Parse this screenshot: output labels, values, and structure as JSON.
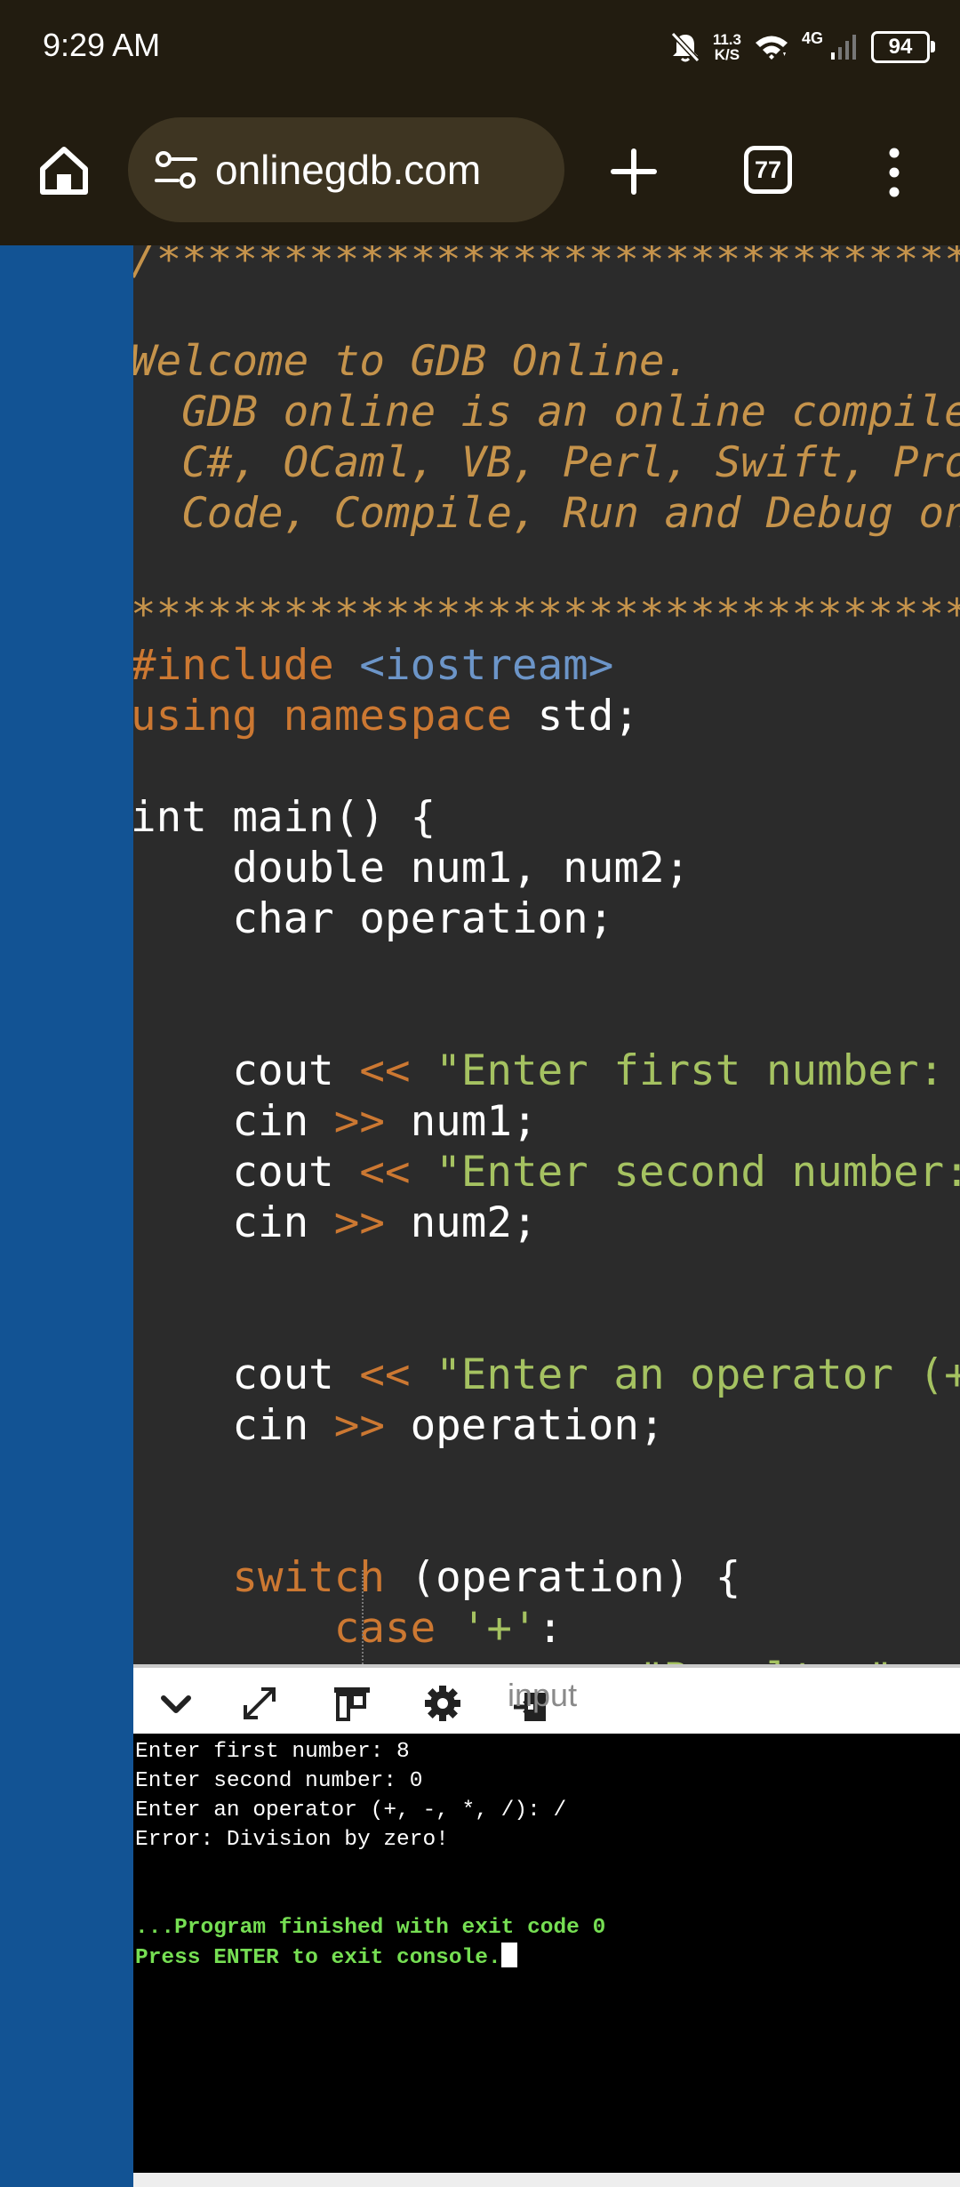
{
  "status_bar": {
    "time": "9:29 AM",
    "net_speed_value": "11.3",
    "net_speed_unit": "K/S",
    "network_type": "4G",
    "battery": "94"
  },
  "browser": {
    "url": "onlinegdb.com",
    "tab_count": "77"
  },
  "editor": {
    "lines": [
      [
        {
          "t": "/************************************",
          "c": "cm"
        }
      ],
      [
        {
          "t": "",
          "c": ""
        }
      ],
      [
        {
          "t": "Welcome to GDB Online.",
          "c": "cm"
        }
      ],
      [
        {
          "t": "  GDB online is an online compile",
          "c": "cm"
        }
      ],
      [
        {
          "t": "  C#, OCaml, VB, Perl, Swift, Pro",
          "c": "cm"
        }
      ],
      [
        {
          "t": "  Code, Compile, Run and Debug on",
          "c": "cm"
        }
      ],
      [
        {
          "t": "",
          "c": ""
        }
      ],
      [
        {
          "t": "*************************************",
          "c": "cm"
        }
      ],
      [
        {
          "t": "#include ",
          "c": "kw"
        },
        {
          "t": "<iostream>",
          "c": "hd"
        }
      ],
      [
        {
          "t": "using namespace ",
          "c": "kw"
        },
        {
          "t": "std;",
          "c": ""
        }
      ],
      [
        {
          "t": "",
          "c": ""
        }
      ],
      [
        {
          "t": "int main() {",
          "c": ""
        }
      ],
      [
        {
          "t": "    double num1, num2;",
          "c": ""
        }
      ],
      [
        {
          "t": "    char operation;",
          "c": ""
        }
      ],
      [
        {
          "t": "",
          "c": ""
        }
      ],
      [
        {
          "t": "",
          "c": ""
        }
      ],
      [
        {
          "t": "    cout ",
          "c": ""
        },
        {
          "t": "<<",
          "c": "op"
        },
        {
          "t": " \"Enter first number: ",
          "c": "st"
        }
      ],
      [
        {
          "t": "    cin ",
          "c": ""
        },
        {
          "t": ">>",
          "c": "op"
        },
        {
          "t": " num1;",
          "c": ""
        }
      ],
      [
        {
          "t": "    cout ",
          "c": ""
        },
        {
          "t": "<<",
          "c": "op"
        },
        {
          "t": " \"Enter second number:",
          "c": "st"
        }
      ],
      [
        {
          "t": "    cin ",
          "c": ""
        },
        {
          "t": ">>",
          "c": "op"
        },
        {
          "t": " num2;",
          "c": ""
        }
      ],
      [
        {
          "t": "",
          "c": ""
        }
      ],
      [
        {
          "t": "",
          "c": ""
        }
      ],
      [
        {
          "t": "    cout ",
          "c": ""
        },
        {
          "t": "<<",
          "c": "op"
        },
        {
          "t": " \"Enter an operator (+",
          "c": "st"
        }
      ],
      [
        {
          "t": "    cin ",
          "c": ""
        },
        {
          "t": ">>",
          "c": "op"
        },
        {
          "t": " operation;",
          "c": ""
        }
      ],
      [
        {
          "t": "",
          "c": ""
        }
      ],
      [
        {
          "t": "",
          "c": ""
        }
      ],
      [
        {
          "t": "    switch ",
          "c": "kw"
        },
        {
          "t": "(operation) {",
          "c": ""
        }
      ],
      [
        {
          "t": "        case ",
          "c": "kw"
        },
        {
          "t": "'+'",
          "c": "st"
        },
        {
          "t": ":",
          "c": ""
        }
      ],
      [
        {
          "t": "                    \"Result: \"",
          "c": "cut"
        }
      ]
    ]
  },
  "console_toolbar": {
    "input_label": "input"
  },
  "console": {
    "lines": [
      {
        "t": "Enter first number: 8",
        "c": ""
      },
      {
        "t": "Enter second number: 0",
        "c": ""
      },
      {
        "t": "Enter an operator (+, -, *, /): /",
        "c": ""
      },
      {
        "t": "Error: Division by zero!",
        "c": ""
      },
      {
        "t": "",
        "c": ""
      },
      {
        "t": "",
        "c": ""
      },
      {
        "t": "...Program finished with exit code 0",
        "c": "con-green"
      },
      {
        "t": "Press ENTER to exit console.",
        "c": "con-green",
        "cursor": true
      }
    ]
  },
  "colors": {
    "chrome_bg": "#221c10",
    "url_bar_bg": "#3e3522",
    "sidebar": "#125394",
    "editor_bg": "#2b2b2b",
    "comment": "#c5934b",
    "keyword": "#cc7832",
    "header": "#6c95c8",
    "string": "#a5c261",
    "console_green": "#76df53"
  }
}
